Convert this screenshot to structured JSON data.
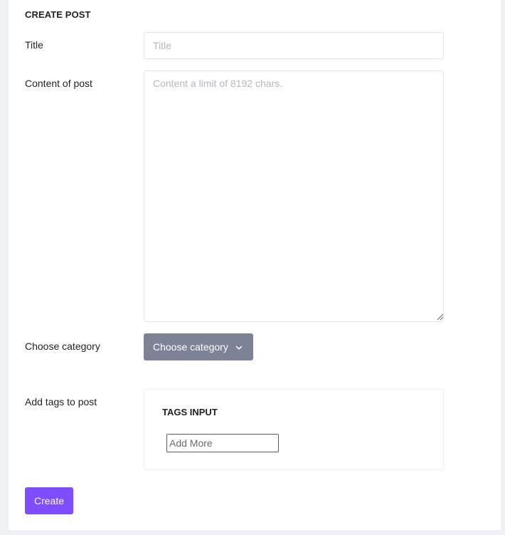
{
  "form": {
    "heading": "CREATE POST",
    "title_label": "Title",
    "title_placeholder": "Title",
    "content_label": "Content of post",
    "content_placeholder": "Content a limit of 8192 chars.",
    "category_label": "Choose category",
    "category_button": "Choose category",
    "tags_label": "Add tags to post",
    "tags_heading": "TAGS INPUT",
    "tags_placeholder": "Add More",
    "submit_label": "Create"
  },
  "icons": {
    "category_chevron": "chevron-down-icon",
    "resize_grip": "resize-grip-icon"
  },
  "colors": {
    "category_button": "#7d8296",
    "submit_button": "#7f4dff",
    "background": "#eef0f4",
    "card": "#ffffff"
  }
}
